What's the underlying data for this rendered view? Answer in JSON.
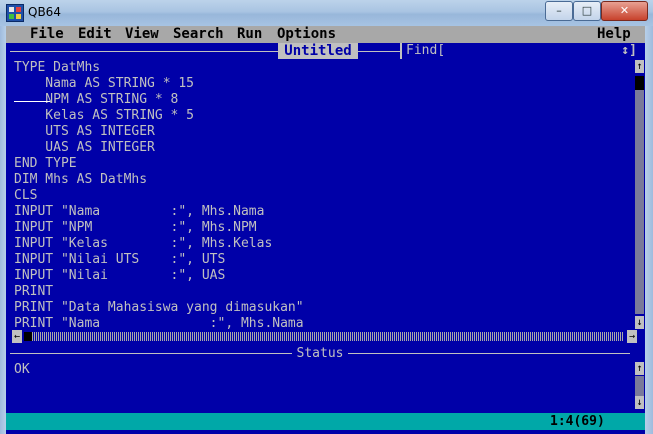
{
  "window": {
    "title": "QB64"
  },
  "menu": [
    "File",
    "Edit",
    "View",
    "Search",
    "Run",
    "Options",
    "Help"
  ],
  "editor": {
    "title": "Untitled",
    "find_label": "Find[",
    "find_arrows": "↕]",
    "lines": [
      "TYPE DatMhs",
      "    Nama AS STRING * 15",
      "    NPM AS STRING * 8",
      "    Kelas AS STRING * 5",
      "    UTS AS INTEGER",
      "    UAS AS INTEGER",
      "END TYPE",
      "DIM Mhs AS DatMhs",
      "CLS",
      "INPUT \"Nama         :\", Mhs.Nama",
      "INPUT \"NPM          :\", Mhs.NPM",
      "INPUT \"Kelas        :\", Mhs.Kelas",
      "INPUT \"Nilai UTS    :\", UTS",
      "INPUT \"Nilai        :\", UAS",
      "PRINT",
      "PRINT \"Data Mahasiswa yang dimasukan\"",
      "PRINT \"Nama              :\", Mhs.Nama"
    ]
  },
  "status": {
    "title": "Status",
    "text": "OK"
  },
  "bottom_bar": {
    "cursor_position": "1:4(69)"
  }
}
